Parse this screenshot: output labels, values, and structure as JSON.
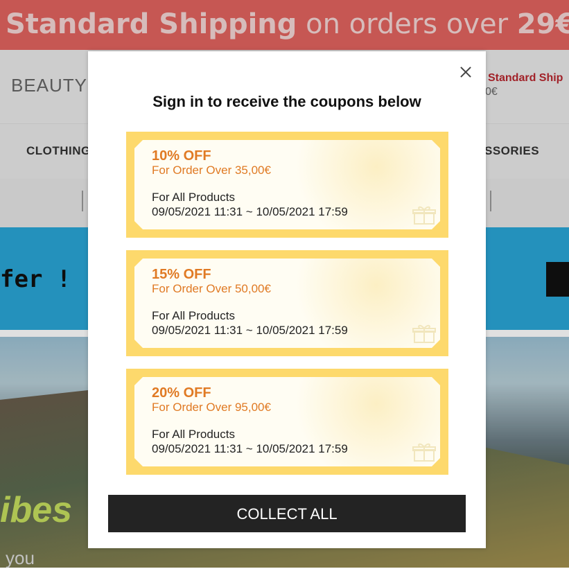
{
  "promo_bar": {
    "bold_part": "Standard Shipping",
    "middle_part": " on orders over ",
    "amount": "29€"
  },
  "header": {
    "brand": "BEAUTY",
    "right_ship": "Standard Ship",
    "right_price": "0€"
  },
  "nav": {
    "left_item": "CLOTHING",
    "right_item": "SSORIES"
  },
  "banner": {
    "text": "fer !"
  },
  "hero": {
    "headline": "ibes",
    "sub": "you"
  },
  "modal": {
    "title": "Sign in to receive the coupons below",
    "coupons": [
      {
        "off": "10% OFF",
        "min": "For Order Over 35,00€",
        "scope": "For All Products",
        "date": "09/05/2021 11:31 ~ 10/05/2021 17:59"
      },
      {
        "off": "15% OFF",
        "min": "For Order Over 50,00€",
        "scope": "For All Products",
        "date": "09/05/2021 11:31 ~ 10/05/2021 17:59"
      },
      {
        "off": "20% OFF",
        "min": "For Order Over 95,00€",
        "scope": "For All Products",
        "date": "09/05/2021 11:31 ~ 10/05/2021 17:59"
      }
    ],
    "collect_label": "COLLECT ALL",
    "icons": {
      "close": "close-icon",
      "gift": "gift-icon"
    }
  },
  "colors": {
    "promo": "#e2645f",
    "banner": "#29a6d6",
    "coupon_border": "#fdd96c",
    "coupon_text": "#e07a24",
    "button": "#232323"
  }
}
